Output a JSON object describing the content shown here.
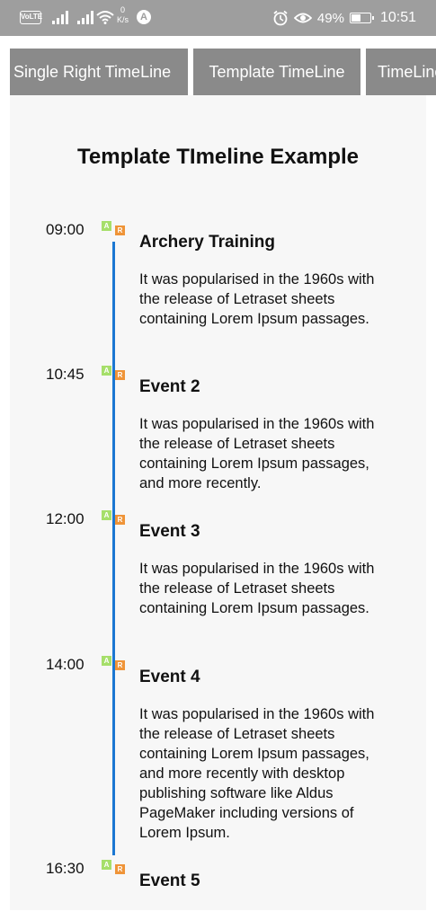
{
  "status_bar": {
    "volte": "VoLTE",
    "net_speed_value": "0",
    "net_speed_unit": "K/s",
    "badge": "A",
    "battery_percent": "49%",
    "time": "10:51",
    "icons": [
      "volte-icon",
      "signal-icon",
      "signal-icon",
      "wifi-icon",
      "net-speed",
      "alarm-icon",
      "eye-icon",
      "battery-icon"
    ]
  },
  "tabs": [
    {
      "label": "Single Right TimeLine"
    },
    {
      "label": "Template TimeLine"
    },
    {
      "label": "TimeLine"
    }
  ],
  "page": {
    "title": "Template TImeline Example"
  },
  "events": [
    {
      "time": "09:00",
      "title": "Archery Training",
      "description": "It was popularised in the 1960s with the release of Letraset sheets containing Lorem Ipsum passages."
    },
    {
      "time": "10:45",
      "title": "Event 2",
      "description": "It was popularised in the 1960s with the release of Letraset sheets containing Lorem Ipsum passages, and more recently."
    },
    {
      "time": "12:00",
      "title": "Event 3",
      "description": "It was popularised in the 1960s with the release of Letraset sheets containing Lorem Ipsum passages."
    },
    {
      "time": "14:00",
      "title": "Event 4",
      "description": "It was popularised in the 1960s with the release of Letraset sheets containing Lorem Ipsum passages, and more recently with desktop publishing software like Aldus PageMaker including versions of Lorem Ipsum."
    },
    {
      "time": "16:30",
      "title": "Event 5",
      "description": ""
    }
  ],
  "event_icon_a_glyph": "A",
  "event_icon_b_glyph": "R",
  "colors": {
    "status_bar": "#9e9e9e",
    "tab": "#8a8a8a",
    "timeline_line": "#1b77d2",
    "icon_green": "#a6df6a",
    "icon_orange": "#ef9438"
  }
}
